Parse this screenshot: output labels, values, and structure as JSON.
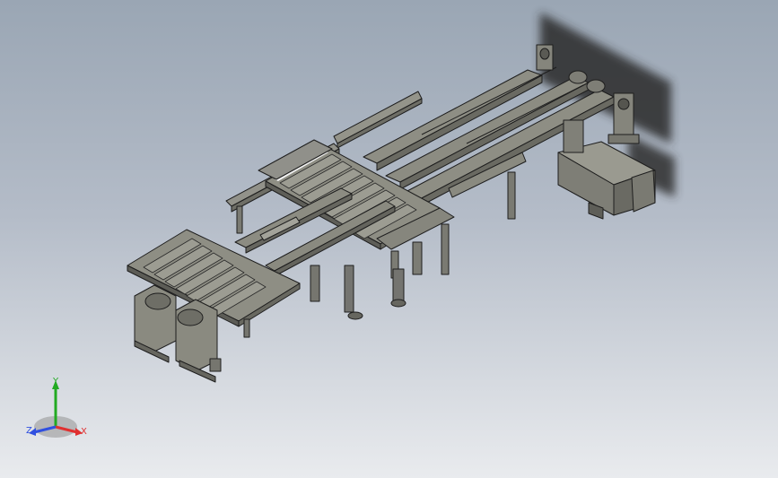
{
  "viewport": {
    "background_top": "#9aa6b4",
    "background_bottom": "#e9ebee"
  },
  "model": {
    "part_color": "#8a8a80",
    "edge_color": "#1e1e1e",
    "motor_color": "#83837a"
  },
  "triad": {
    "x_label": "X",
    "y_label": "Y",
    "z_label": "Z",
    "x_color": "#e03030",
    "y_color": "#22aa22",
    "z_color": "#3050e0"
  }
}
